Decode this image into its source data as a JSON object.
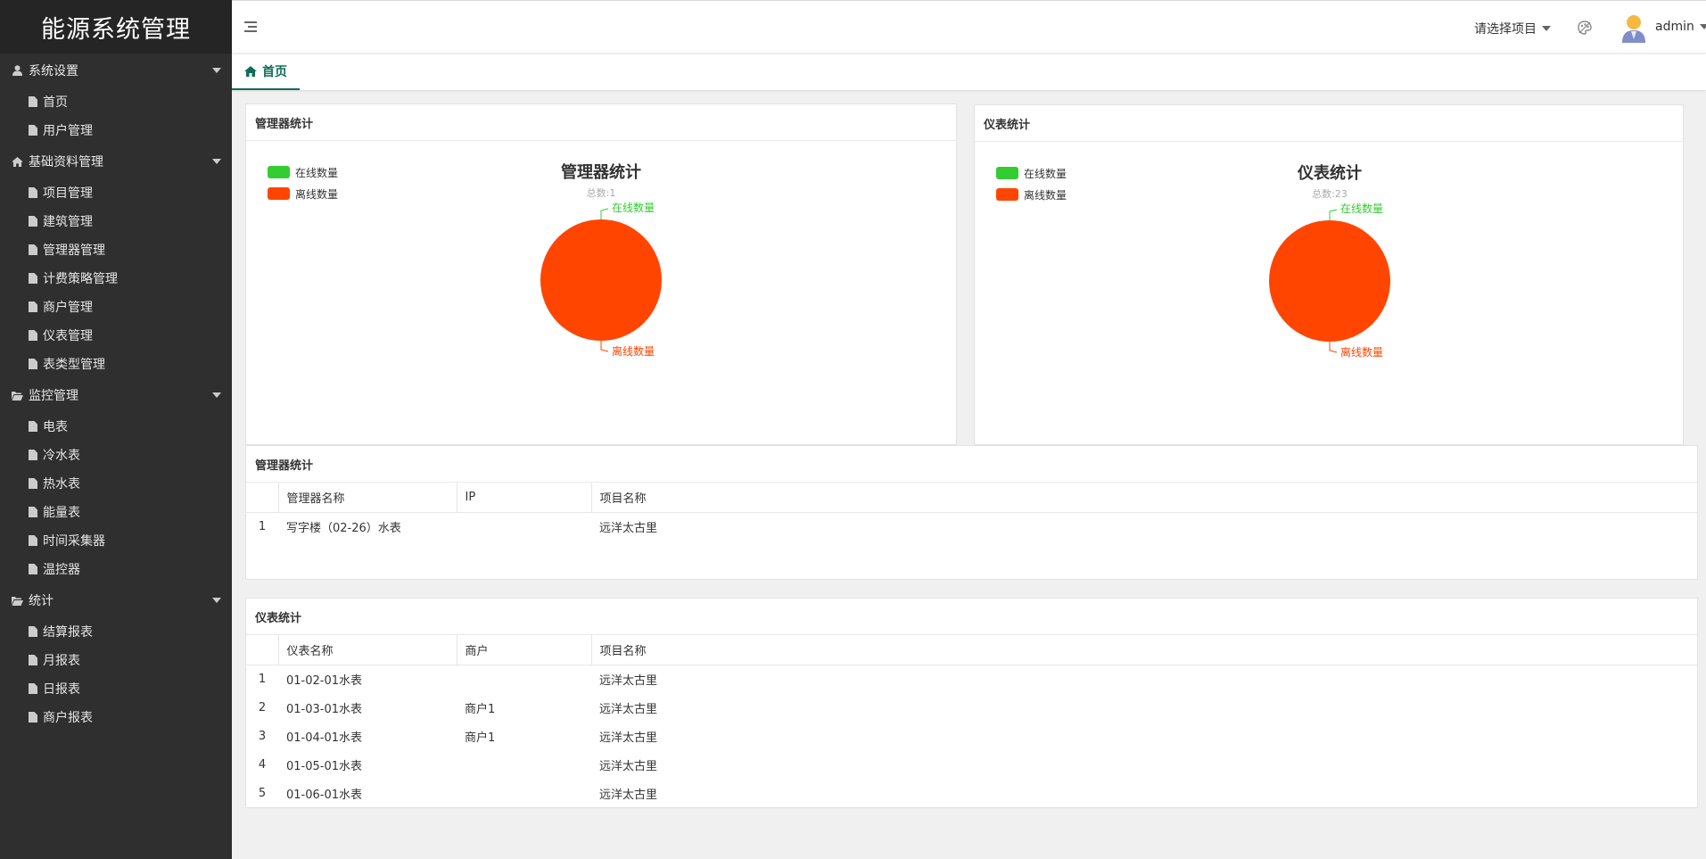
{
  "app": {
    "title": "能源系统管理"
  },
  "sidebar": {
    "groups": [
      {
        "label": "系统设置",
        "icon": "user-icon",
        "items": [
          "首页",
          "用户管理"
        ]
      },
      {
        "label": "基础资料管理",
        "icon": "home-icon",
        "items": [
          "项目管理",
          "建筑管理",
          "管理器管理",
          "计费策略管理",
          "商户管理",
          "仪表管理",
          "表类型管理"
        ]
      },
      {
        "label": "监控管理",
        "icon": "folder-open-icon",
        "items": [
          "电表",
          "冷水表",
          "热水表",
          "能量表",
          "时间采集器",
          "温控器"
        ]
      },
      {
        "label": "统计",
        "icon": "folder-open-icon",
        "items": [
          "结算报表",
          "月报表",
          "日报表",
          "商户报表"
        ]
      }
    ]
  },
  "header": {
    "menu_icon": "menu-collapse-icon",
    "project_select": "请选择项目",
    "theme_icon": "theme-icon",
    "user": "admin"
  },
  "tabs": [
    {
      "label": "首页",
      "icon": "home-icon"
    }
  ],
  "colors": {
    "online": "#33cc33",
    "offline": "#ff4500",
    "accent": "#0f6e5a",
    "sidebar": "#2f2f2f"
  },
  "manager_panel": {
    "title": "管理器统计",
    "chart_title": "管理器统计",
    "chart_sub": "总数:1"
  },
  "meter_panel": {
    "title": "仪表统计",
    "chart_title": "仪表统计",
    "chart_sub": "总数:23"
  },
  "chart_data": [
    {
      "type": "pie",
      "title": "管理器统计",
      "subtitle": "总数:1",
      "categories": [
        "在线数量",
        "离线数量"
      ],
      "values": [
        0,
        1
      ],
      "legend": "top-left"
    },
    {
      "type": "pie",
      "title": "仪表统计",
      "subtitle": "总数:23",
      "categories": [
        "在线数量",
        "离线数量"
      ],
      "values": [
        0,
        23
      ],
      "legend": "top-left"
    }
  ],
  "manager_table": {
    "title": "管理器统计",
    "columns": [
      "",
      "管理器名称",
      "IP",
      "项目名称"
    ],
    "rows": [
      [
        "1",
        "写字楼（02-26）水表",
        "",
        "远洋太古里"
      ]
    ]
  },
  "meter_table": {
    "title": "仪表统计",
    "columns": [
      "",
      "仪表名称",
      "商户",
      "项目名称"
    ],
    "rows": [
      [
        "1",
        "01-02-01水表",
        "",
        "远洋太古里"
      ],
      [
        "2",
        "01-03-01水表",
        "商户1",
        "远洋太古里"
      ],
      [
        "3",
        "01-04-01水表",
        "商户1",
        "远洋太古里"
      ],
      [
        "4",
        "01-05-01水表",
        "",
        "远洋太古里"
      ],
      [
        "5",
        "01-06-01水表",
        "",
        "远洋太古里"
      ]
    ]
  }
}
